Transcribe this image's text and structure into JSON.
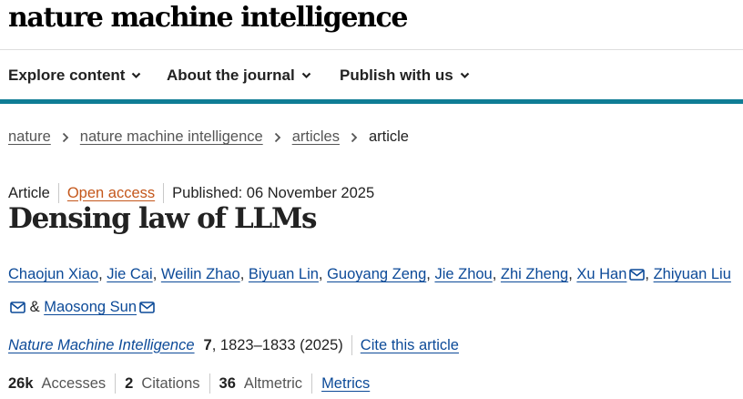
{
  "site": {
    "logo_text": "nature machine intelligence"
  },
  "nav": {
    "items": [
      {
        "label": "Explore content"
      },
      {
        "label": "About the journal"
      },
      {
        "label": "Publish with us"
      }
    ]
  },
  "breadcrumb": {
    "items": [
      "nature",
      "nature machine intelligence",
      "articles"
    ],
    "current": "article"
  },
  "article": {
    "type": "Article",
    "access": "Open access",
    "published": "Published: 06 November 2025",
    "title": "Densing law of LLMs",
    "authors": [
      {
        "name": "Chaojun Xiao"
      },
      {
        "name": "Jie Cai"
      },
      {
        "name": "Weilin Zhao"
      },
      {
        "name": "Biyuan Lin"
      },
      {
        "name": "Guoyang Zeng"
      },
      {
        "name": "Jie Zhou"
      },
      {
        "name": "Zhi Zheng"
      },
      {
        "name": "Xu Han"
      },
      {
        "name": "Zhiyuan Liu"
      },
      {
        "name": "Maosong Sun"
      }
    ],
    "author_joiner": "&",
    "journal": "Nature Machine Intelligence",
    "volume": "7",
    "pages_year": ", 1823–1833 (2025)",
    "cite_label": "Cite this article"
  },
  "metrics": {
    "accesses_value": "26k",
    "accesses_label": "Accesses",
    "citations_value": "2",
    "citations_label": "Citations",
    "altmetric_value": "36",
    "altmetric_label": "Altmetric",
    "link_label": "Metrics"
  },
  "colors": {
    "nav_underline": "#0f7d95",
    "link": "#0c4a98",
    "open_access": "#c4571b"
  },
  "icons": [
    "chevron-down-icon",
    "chevron-right-icon",
    "mail-icon"
  ]
}
